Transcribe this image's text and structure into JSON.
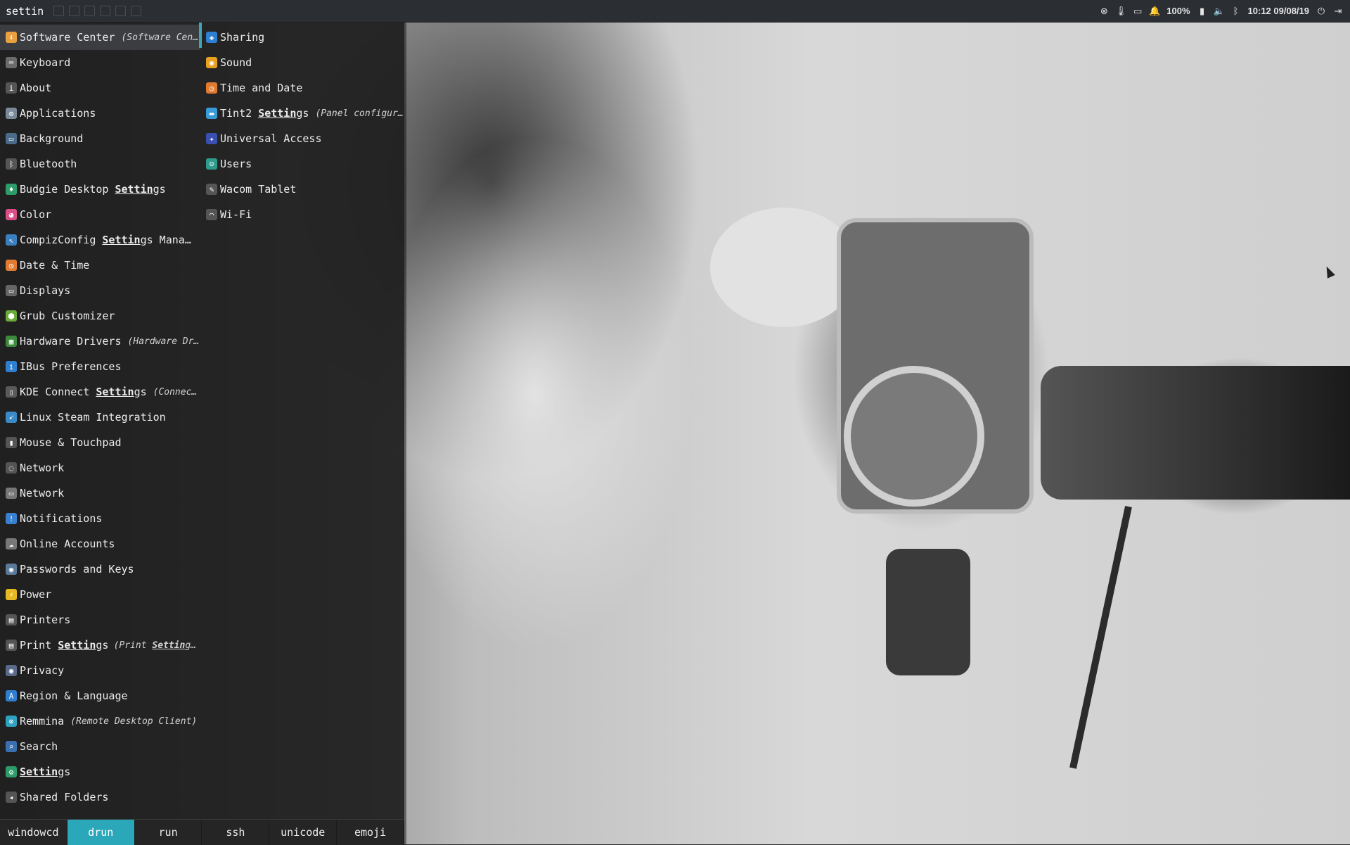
{
  "search": {
    "value": "settin"
  },
  "tray": {
    "battery_percent": "100%",
    "datetime": "10:12 09/08/19"
  },
  "launcher": {
    "column1": [
      {
        "name_pre": "Software Center",
        "name_hl": "",
        "name_post": "",
        "comment": "(Software Cen…",
        "icon": "software-center-icon",
        "icon_color": "#e8a040",
        "selected": true
      },
      {
        "name_pre": "Keyboard",
        "name_hl": "",
        "name_post": "",
        "comment": "",
        "icon": "keyboard-icon",
        "icon_color": "#6b6b6b"
      },
      {
        "name_pre": "About",
        "name_hl": "",
        "name_post": "",
        "comment": "",
        "icon": "info-icon",
        "icon_color": "#555555"
      },
      {
        "name_pre": "Applications",
        "name_hl": "",
        "name_post": "",
        "comment": "",
        "icon": "applications-gear-icon",
        "icon_color": "#7a8a9a"
      },
      {
        "name_pre": "Background",
        "name_hl": "",
        "name_post": "",
        "comment": "",
        "icon": "background-icon",
        "icon_color": "#4a6b8a"
      },
      {
        "name_pre": "Bluetooth",
        "name_hl": "",
        "name_post": "",
        "comment": "",
        "icon": "bluetooth-icon",
        "icon_color": "#555555"
      },
      {
        "name_pre": "Budgie Desktop ",
        "name_hl": "Settin",
        "name_post": "gs",
        "comment": "",
        "icon": "budgie-icon",
        "icon_color": "#2e9b6b"
      },
      {
        "name_pre": "Color",
        "name_hl": "",
        "name_post": "",
        "comment": "",
        "icon": "color-icon",
        "icon_color": "#d94e86"
      },
      {
        "name_pre": "CompizConfig ",
        "name_hl": "Settin",
        "name_post": "gs Mana…",
        "comment": "",
        "icon": "compiz-icon",
        "icon_color": "#3a7fc0"
      },
      {
        "name_pre": "Date & Time",
        "name_hl": "",
        "name_post": "",
        "comment": "",
        "icon": "clock-icon",
        "icon_color": "#e07a30"
      },
      {
        "name_pre": "Displays",
        "name_hl": "",
        "name_post": "",
        "comment": "",
        "icon": "display-icon",
        "icon_color": "#666666"
      },
      {
        "name_pre": "Grub Customizer",
        "name_hl": "",
        "name_post": "",
        "comment": "",
        "icon": "grub-icon",
        "icon_color": "#6aaa3a"
      },
      {
        "name_pre": "Hardware Drivers",
        "name_hl": "",
        "name_post": "",
        "comment": "(Hardware Dr…",
        "icon": "chip-icon",
        "icon_color": "#3d8a3d"
      },
      {
        "name_pre": "IBus Preferences",
        "name_hl": "",
        "name_post": "",
        "comment": "",
        "icon": "ibus-icon",
        "icon_color": "#2f7fd1"
      },
      {
        "name_pre": "KDE Connect ",
        "name_hl": "Settin",
        "name_post": "gs",
        "comment": "(Connec…",
        "icon": "kde-connect-icon",
        "icon_color": "#5a5a5a"
      },
      {
        "name_pre": "Linux Steam Integration",
        "name_hl": "",
        "name_post": "",
        "comment": "",
        "icon": "steam-icon",
        "icon_color": "#3a8ac8"
      },
      {
        "name_pre": "Mouse & Touchpad",
        "name_hl": "",
        "name_post": "",
        "comment": "",
        "icon": "mouse-icon",
        "icon_color": "#555555"
      },
      {
        "name_pre": "Network",
        "name_hl": "",
        "name_post": "",
        "comment": "",
        "icon": "network-icon",
        "icon_color": "#555555"
      },
      {
        "name_pre": "Network",
        "name_hl": "",
        "name_post": "",
        "comment": "",
        "icon": "network-wired-icon",
        "icon_color": "#777777"
      },
      {
        "name_pre": "Notifications",
        "name_hl": "",
        "name_post": "",
        "comment": "",
        "icon": "notification-icon",
        "icon_color": "#3a80d0"
      },
      {
        "name_pre": "Online Accounts",
        "name_hl": "",
        "name_post": "",
        "comment": "",
        "icon": "cloud-icon",
        "icon_color": "#777777"
      },
      {
        "name_pre": "Passwords and Keys",
        "name_hl": "",
        "name_post": "",
        "comment": "",
        "icon": "keyring-icon",
        "icon_color": "#5a7a9a"
      },
      {
        "name_pre": "Power",
        "name_hl": "",
        "name_post": "",
        "comment": "",
        "icon": "power-icon",
        "icon_color": "#e8b820"
      },
      {
        "name_pre": "Printers",
        "name_hl": "",
        "name_post": "",
        "comment": "",
        "icon": "printer-icon",
        "icon_color": "#555555"
      },
      {
        "name_pre": "Print ",
        "name_hl": "Settin",
        "name_post": "gs",
        "comment_pre": "(Print ",
        "comment_hl": "Settin",
        "comment_post": "gs)",
        "icon": "printer-icon",
        "icon_color": "#555555"
      },
      {
        "name_pre": "Privacy",
        "name_hl": "",
        "name_post": "",
        "comment": "",
        "icon": "privacy-icon",
        "icon_color": "#5a6a8a"
      },
      {
        "name_pre": "Region & Language",
        "name_hl": "",
        "name_post": "",
        "comment": "",
        "icon": "language-icon",
        "icon_color": "#2f7fd1"
      },
      {
        "name_pre": "Remmina",
        "name_hl": "",
        "name_post": "",
        "comment": "(Remote Desktop Client)",
        "icon": "remmina-icon",
        "icon_color": "#2fa0c0"
      },
      {
        "name_pre": "Search",
        "name_hl": "",
        "name_post": "",
        "comment": "",
        "icon": "search-icon",
        "icon_color": "#3a70b0"
      },
      {
        "name_pre": "",
        "name_hl": "Settin",
        "name_post": "gs",
        "comment": "",
        "icon": "settings-icon",
        "icon_color": "#2e9b6b"
      },
      {
        "name_pre": "Shared Folders",
        "name_hl": "",
        "name_post": "",
        "comment": "",
        "icon": "share-icon",
        "icon_color": "#555555"
      }
    ],
    "column2": [
      {
        "name_pre": "Sharing",
        "name_hl": "",
        "name_post": "",
        "comment": "",
        "icon": "sharing-icon",
        "icon_color": "#2f7fd1"
      },
      {
        "name_pre": "Sound",
        "name_hl": "",
        "name_post": "",
        "comment": "",
        "icon": "sound-icon",
        "icon_color": "#e8a020"
      },
      {
        "name_pre": "Time and Date",
        "name_hl": "",
        "name_post": "",
        "comment": "",
        "icon": "clock-icon",
        "icon_color": "#e07a30"
      },
      {
        "name_pre": "Tint2 ",
        "name_hl": "Settin",
        "name_post": "gs",
        "comment": "(Panel configur…",
        "icon": "tint2-icon",
        "icon_color": "#3a9ad8"
      },
      {
        "name_pre": "Universal Access",
        "name_hl": "",
        "name_post": "",
        "comment": "",
        "icon": "accessibility-icon",
        "icon_color": "#3a50b0"
      },
      {
        "name_pre": "Users",
        "name_hl": "",
        "name_post": "",
        "comment": "",
        "icon": "users-icon",
        "icon_color": "#2e9b8b"
      },
      {
        "name_pre": "Wacom Tablet",
        "name_hl": "",
        "name_post": "",
        "comment": "",
        "icon": "tablet-icon",
        "icon_color": "#555555"
      },
      {
        "name_pre": "Wi-Fi",
        "name_hl": "",
        "name_post": "",
        "comment": "",
        "icon": "wifi-icon",
        "icon_color": "#555555"
      }
    ]
  },
  "modes": [
    "windowcd",
    "drun",
    "run",
    "ssh",
    "unicode",
    "emoji"
  ],
  "active_mode": "drun",
  "colors": {
    "accent": "#2aa7b8",
    "panel": "#2b2e33",
    "launcher_bg": "#1e1e1e",
    "text": "#ececec"
  }
}
